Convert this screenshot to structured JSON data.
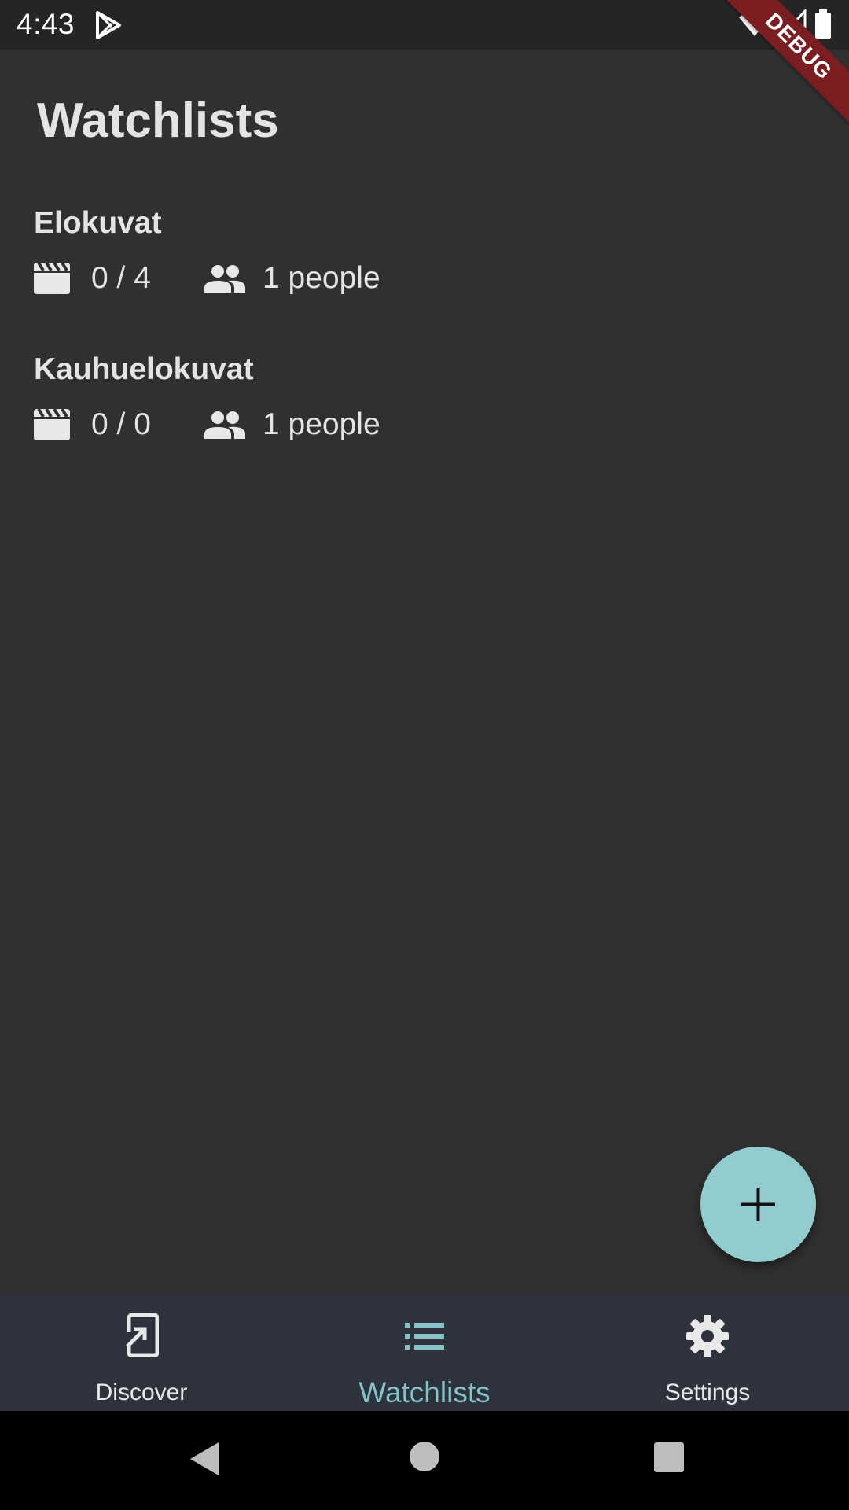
{
  "status_bar": {
    "time": "4:43"
  },
  "debug_banner": "DEBUG",
  "page": {
    "title": "Watchlists"
  },
  "watchlists": [
    {
      "name": "Elokuvat",
      "movies": "0 / 4",
      "people": "1 people"
    },
    {
      "name": "Kauhuelokuvat",
      "movies": "0 / 0",
      "people": "1 people"
    }
  ],
  "fab": {
    "icon": "plus-icon"
  },
  "bottom_nav": {
    "items": [
      {
        "label": "Discover",
        "icon": "discover-icon",
        "active": false
      },
      {
        "label": "Watchlists",
        "icon": "list-icon",
        "active": true
      },
      {
        "label": "Settings",
        "icon": "gear-icon",
        "active": false
      }
    ]
  },
  "colors": {
    "background": "#303030",
    "accent": "#93ccce",
    "nav_active": "#86c3c6",
    "nav_background": "#2d323c",
    "debug_ribbon": "#7b1e21"
  }
}
